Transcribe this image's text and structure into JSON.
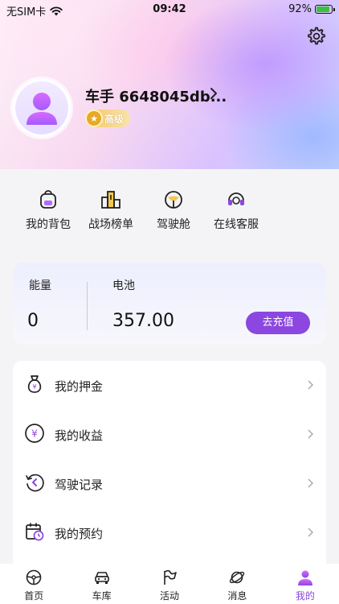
{
  "status_bar": {
    "carrier": "无SIM卡",
    "time": "09:42",
    "battery_percent": "92%",
    "battery_level": 0.92
  },
  "profile": {
    "username": "车手 6648045db...",
    "badge_label": "高级"
  },
  "quick_actions": [
    {
      "label": "我的背包",
      "icon": "backpack-icon"
    },
    {
      "label": "战场榜单",
      "icon": "leaderboard-icon"
    },
    {
      "label": "驾驶舱",
      "icon": "steering-wheel-icon"
    },
    {
      "label": "在线客服",
      "icon": "headset-icon"
    }
  ],
  "energy": {
    "energy_label": "能量",
    "energy_value": "0",
    "battery_label": "电池",
    "battery_value": "357.00",
    "recharge_label": "去充值"
  },
  "menu": [
    {
      "label": "我的押金",
      "icon": "money-bag-icon"
    },
    {
      "label": "我的收益",
      "icon": "yuan-coin-icon"
    },
    {
      "label": "驾驶记录",
      "icon": "history-icon"
    },
    {
      "label": "我的预约",
      "icon": "calendar-clock-icon"
    }
  ],
  "tabs": [
    {
      "label": "首页",
      "icon": "steering-wheel-icon",
      "active": false
    },
    {
      "label": "车库",
      "icon": "car-icon",
      "active": false
    },
    {
      "label": "活动",
      "icon": "flag-icon",
      "active": false
    },
    {
      "label": "消息",
      "icon": "planet-icon",
      "active": false
    },
    {
      "label": "我的",
      "icon": "user-icon",
      "active": true
    }
  ],
  "colors": {
    "accent": "#8b47df",
    "battery_fill": "#3cc13b",
    "badge_gold": "#e8a926"
  }
}
